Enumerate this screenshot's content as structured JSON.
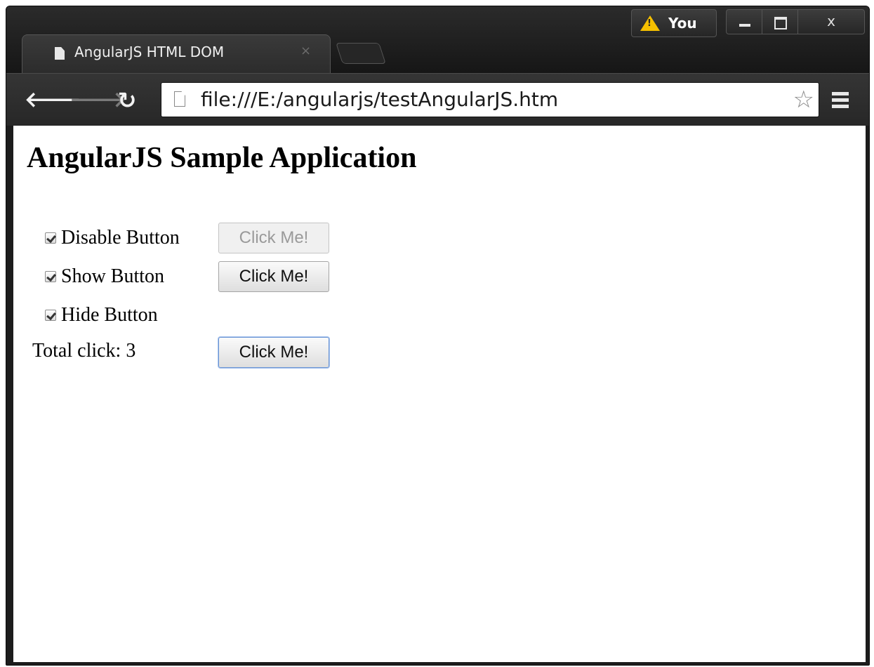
{
  "browser": {
    "tab": {
      "title": "AngularJS HTML DOM",
      "close_glyph": "×"
    },
    "profile": {
      "name": "You",
      "icon": "warning-icon",
      "icon_color": "#f6c000"
    },
    "window_controls": {
      "close_glyph": "x"
    },
    "toolbar": {
      "back_glyph": "🡐",
      "forward_glyph": "🡒",
      "reload_glyph": "↻",
      "url": "file:///E:/angularjs/testAngularJS.htm",
      "star_glyph": "☆"
    }
  },
  "page": {
    "title": "AngularJS Sample Application",
    "rows": [
      {
        "label": "Disable Button",
        "checked": true,
        "button_label": "Click Me!",
        "button_disabled": true
      },
      {
        "label": "Show Button",
        "checked": true,
        "button_label": "Click Me!",
        "button_disabled": false
      },
      {
        "label": "Hide Button",
        "checked": true
      }
    ],
    "total": {
      "text": "Total click: 3",
      "button_label": "Click Me!"
    }
  }
}
